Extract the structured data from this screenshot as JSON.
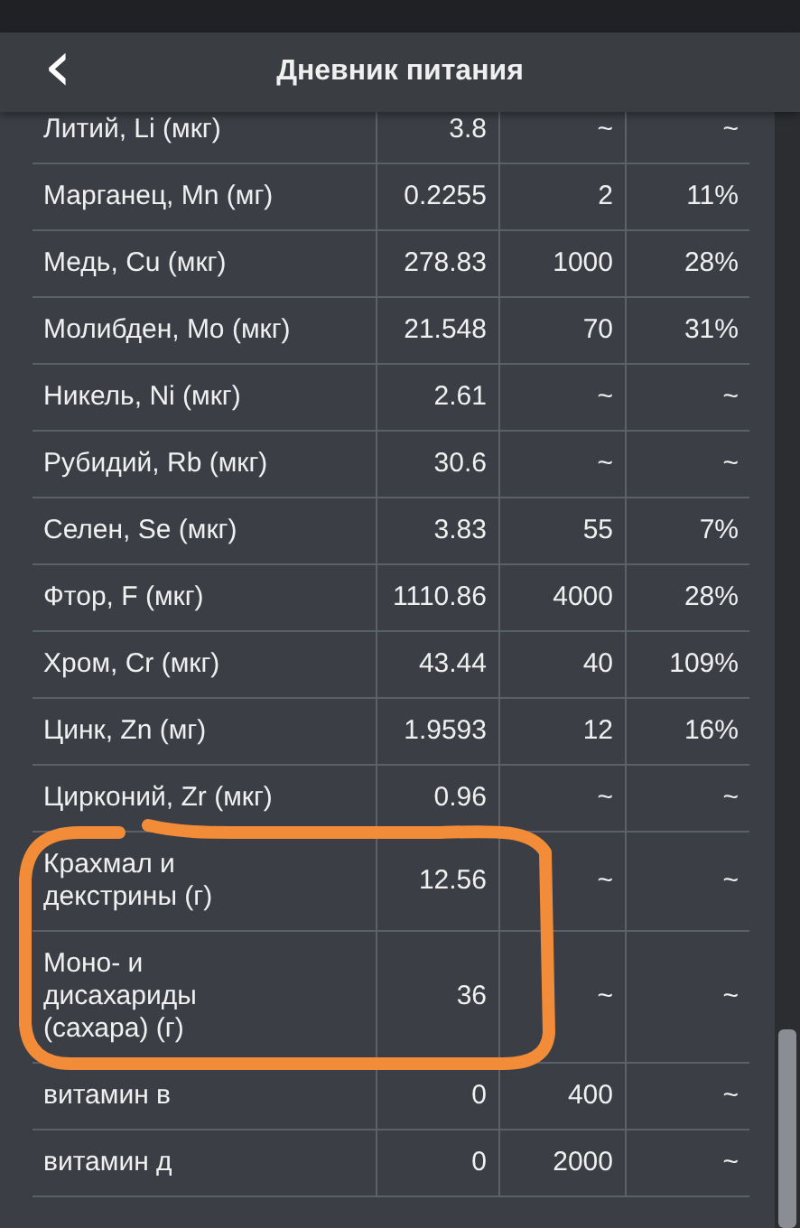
{
  "header": {
    "back_icon": "‹",
    "title": "Дневник питания"
  },
  "rows": [
    {
      "name": "Литий, Li (мкг)",
      "value": "3.8",
      "norm": "~",
      "percent": "~"
    },
    {
      "name": "Марганец, Mn (мг)",
      "value": "0.2255",
      "norm": "2",
      "percent": "11%"
    },
    {
      "name": "Медь, Cu (мкг)",
      "value": "278.83",
      "norm": "1000",
      "percent": "28%"
    },
    {
      "name": "Молибден, Mo (мкг)",
      "value": "21.548",
      "norm": "70",
      "percent": "31%"
    },
    {
      "name": "Никель, Ni (мкг)",
      "value": "2.61",
      "norm": "~",
      "percent": "~"
    },
    {
      "name": "Рубидий, Rb (мкг)",
      "value": "30.6",
      "norm": "~",
      "percent": "~"
    },
    {
      "name": "Селен, Se (мкг)",
      "value": "3.83",
      "norm": "55",
      "percent": "7%"
    },
    {
      "name": "Фтор, F (мкг)",
      "value": "1110.86",
      "norm": "4000",
      "percent": "28%"
    },
    {
      "name": "Хром, Cr (мкг)",
      "value": "43.44",
      "norm": "40",
      "percent": "109%"
    },
    {
      "name": "Цинк, Zn (мг)",
      "value": "1.9593",
      "norm": "12",
      "percent": "16%"
    },
    {
      "name": "Цирконий, Zr (мкг)",
      "value": "0.96",
      "norm": "~",
      "percent": "~"
    },
    {
      "name": "Крахмал и декстрины (г)",
      "value": "12.56",
      "norm": "~",
      "percent": "~"
    },
    {
      "name": "Моно- и дисахариды (сахара) (г)",
      "value": "36",
      "norm": "~",
      "percent": "~"
    },
    {
      "name": "витамин в",
      "value": "0",
      "norm": "400",
      "percent": "~"
    },
    {
      "name": "витамин д",
      "value": "0",
      "norm": "2000",
      "percent": "~"
    }
  ],
  "highlight": {
    "kind": "freehand"
  }
}
